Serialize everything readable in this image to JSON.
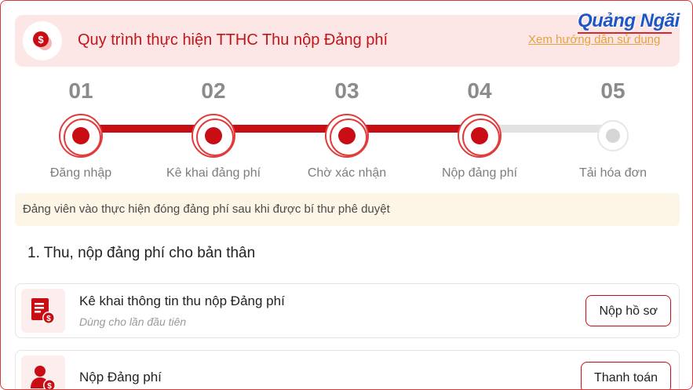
{
  "header": {
    "title": "Quy trình thực hiện TTHC Thu nộp Đảng phí",
    "guide_link": "Xem hướng dẫn sử dụng",
    "icon": "coin-icon",
    "watermark": "Quảng Ngãi"
  },
  "steps": [
    {
      "number": "01",
      "label": "Đăng nhập",
      "status": "done"
    },
    {
      "number": "02",
      "label": "Kê khai đảng phí",
      "status": "done"
    },
    {
      "number": "03",
      "label": "Chờ xác nhận",
      "status": "done"
    },
    {
      "number": "04",
      "label": "Nộp đảng phí",
      "status": "current"
    },
    {
      "number": "05",
      "label": "Tải hóa đơn",
      "status": "pending"
    }
  ],
  "notice": "Đảng viên vào thực hiện đóng đảng phí sau khi được bí thư phê duyệt",
  "section": {
    "title": "1. Thu, nộp đảng phí cho bản thân"
  },
  "cards": [
    {
      "title": "Kê khai thông tin thu nộp Đảng phí",
      "subtitle": "Dùng cho lần đầu tiên",
      "button": "Nộp hồ sơ",
      "icon": "document-coin-icon"
    },
    {
      "title": "Nộp Đảng phí",
      "subtitle": "",
      "button": "Thanh toán",
      "icon": "user-coin-icon"
    }
  ],
  "colors": {
    "accent": "#c80e14",
    "header_bg": "#fde6e6",
    "notice_bg": "#fdf5e6",
    "link": "#e8a13b"
  }
}
